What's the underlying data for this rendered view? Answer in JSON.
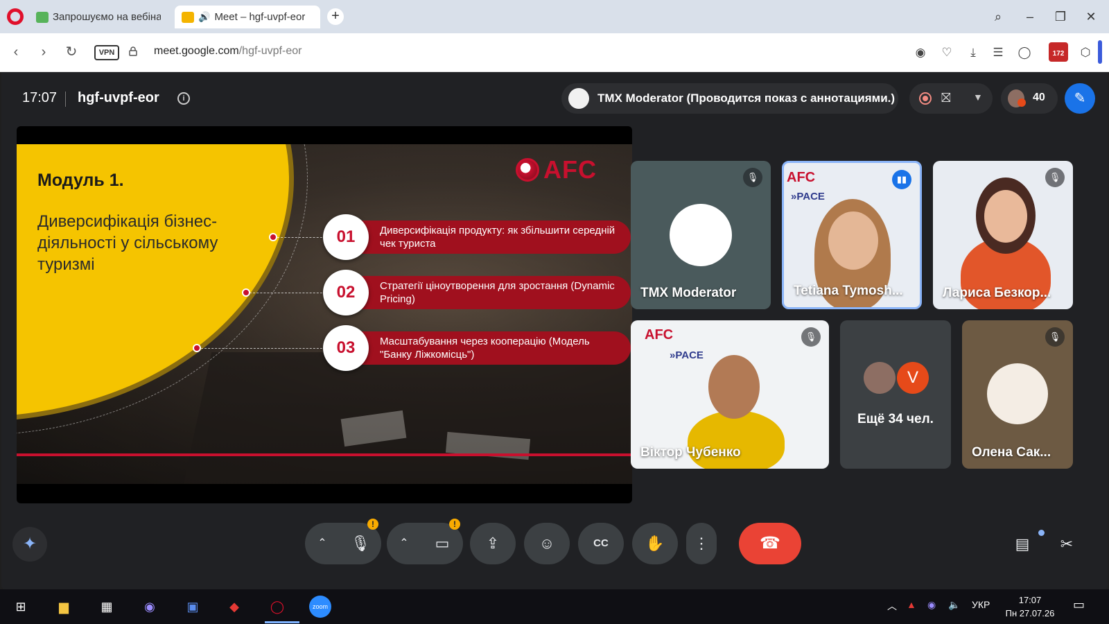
{
  "browser": {
    "tabs": [
      {
        "title": "Запрошуємо на вебінар",
        "active": false
      },
      {
        "title": "Meet – hgf-uvpf-eor",
        "active": true
      }
    ],
    "new_tab": "+",
    "url_host": "meet.google.com",
    "url_path": "/hgf-uvpf-eor",
    "vpn_label": "VPN",
    "extension_badge": "172"
  },
  "meet": {
    "time": "17:07",
    "meeting_code": "hgf-uvpf-eor",
    "presenter_status": "TMX Moderator (Проводится показ с аннотациями.)",
    "participant_count": "40",
    "slide": {
      "module_title": "Модуль 1.",
      "module_subtitle": "Диверсифікація бізнес-діяльності у сільському туризмі",
      "logo_text": "AFC",
      "items": [
        {
          "num": "01",
          "text": "Диверсифікація продукту: як збільшити середній чек туриста"
        },
        {
          "num": "02",
          "text": "Стратегії ціноутворення для зростання (Dynamic Pricing)"
        },
        {
          "num": "03",
          "text": "Масштабування через кооперацію (Модель \"Банку Ліжкомісць\")"
        }
      ]
    },
    "tiles": [
      {
        "name": "TMX Moderator"
      },
      {
        "name": "Tetiana Tymosh..."
      },
      {
        "name": "Лариса Безкор..."
      },
      {
        "name": "Віктор Чубенко"
      },
      {
        "name": "Ещё 34 чел.",
        "avatar_letter": "V"
      },
      {
        "name": "Олена Сак..."
      }
    ]
  },
  "taskbar": {
    "language": "УКР",
    "clock_time": "17:07",
    "clock_date": "Пн 27.07.26"
  },
  "colors": {
    "meet_bg": "#202124",
    "end_call": "#ea4335",
    "slide_yellow": "#f5c400",
    "afc_red": "#c8102e",
    "accent_blue": "#1a73e8"
  }
}
